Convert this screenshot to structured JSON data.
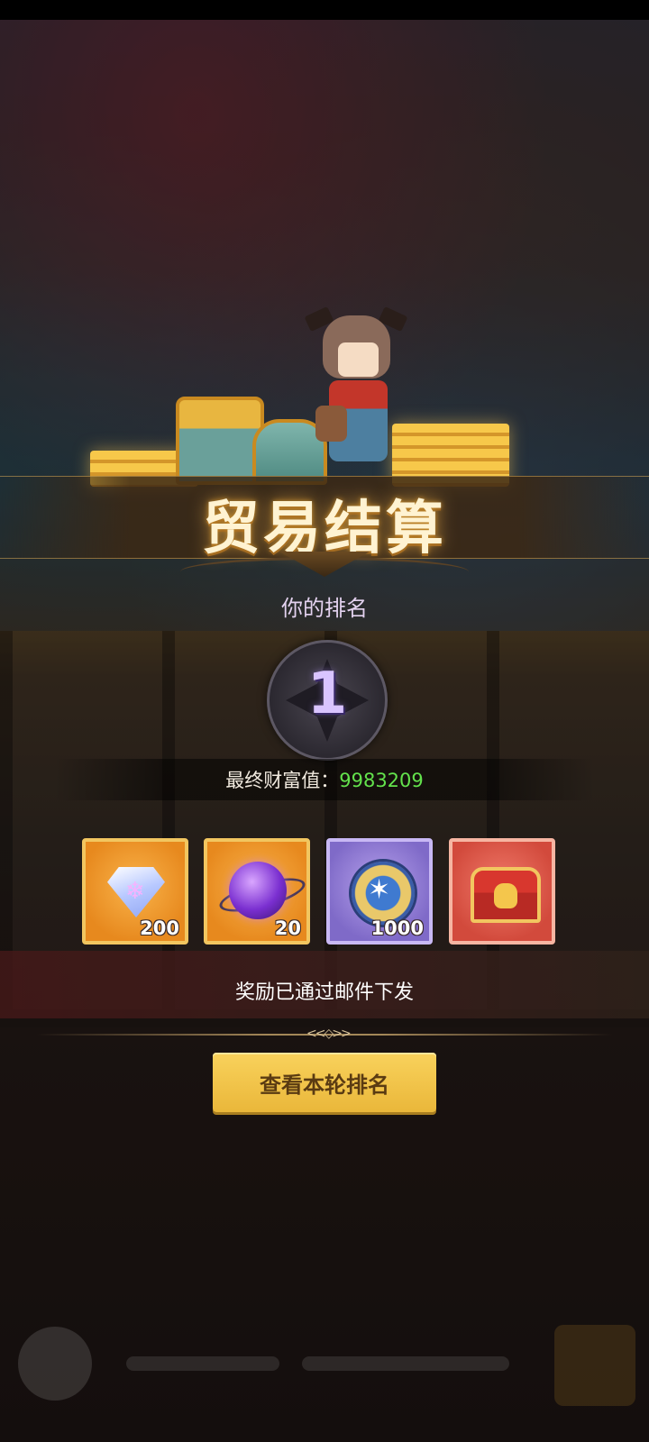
{
  "result": {
    "title": "贸易结算",
    "rank_label": "你的排名",
    "rank": "1",
    "wealth_label": "最终财富值：",
    "wealth_value": "9983209"
  },
  "rewards": [
    {
      "item": "diamond",
      "icon": "diamond-icon",
      "quantity": "200"
    },
    {
      "item": "purple-orb",
      "icon": "orb-icon",
      "quantity": "20"
    },
    {
      "item": "medal",
      "icon": "medal-icon",
      "quantity": "1000"
    },
    {
      "item": "treasure-chest",
      "icon": "chest-icon",
      "quantity": ""
    }
  ],
  "notice": "奖励已通过邮件下发",
  "actions": {
    "view_rankings": "查看本轮排名"
  },
  "colors": {
    "wealth_value": "#63e24c",
    "button": "#f3c64a",
    "title_glow": "#c58a2a"
  }
}
